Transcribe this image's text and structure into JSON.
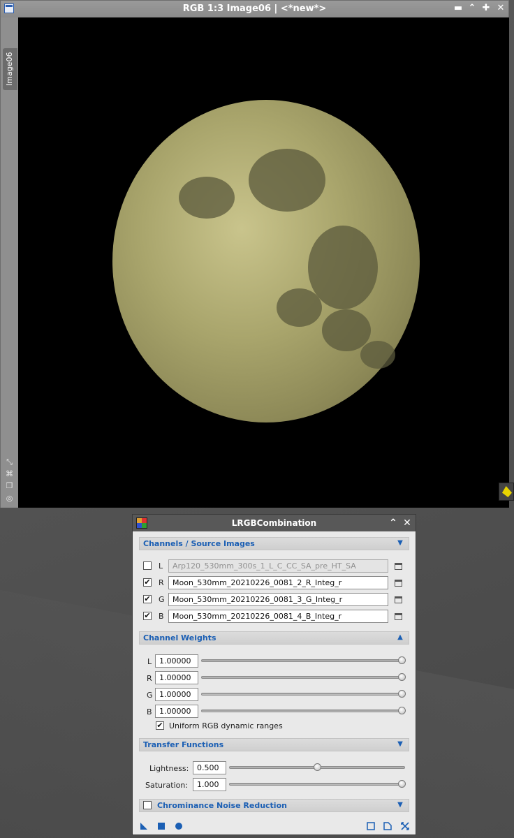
{
  "image_window": {
    "title": "RGB 1:3 Image06 | <*new*>",
    "side_tab_label": "Image06",
    "buttons": {
      "minimize": "▬",
      "shade": "⌃",
      "maximize": "✚",
      "close": "✕"
    }
  },
  "dialog": {
    "title": "LRGBCombination",
    "sections": {
      "channels": {
        "title": "Channels / Source Images",
        "expanded": true
      },
      "weights": {
        "title": "Channel Weights",
        "expanded": true
      },
      "transfer": {
        "title": "Transfer Functions",
        "expanded": true
      },
      "noise": {
        "title": "Chrominance Noise Reduction",
        "expanded": false,
        "enabled": false
      }
    },
    "channels": [
      {
        "label": "L",
        "checked": false,
        "image": "Arp120_530mm_300s_1_L_C_CC_SA_pre_HT_SA"
      },
      {
        "label": "R",
        "checked": true,
        "image": "Moon_530mm_20210226_0081_2_R_Integ_r"
      },
      {
        "label": "G",
        "checked": true,
        "image": "Moon_530mm_20210226_0081_3_G_Integ_r"
      },
      {
        "label": "B",
        "checked": true,
        "image": "Moon_530mm_20210226_0081_4_B_Integ_r"
      }
    ],
    "weights": [
      {
        "label": "L",
        "value": "1.00000",
        "level": 1.0
      },
      {
        "label": "R",
        "value": "1.00000",
        "level": 1.0
      },
      {
        "label": "G",
        "value": "1.00000",
        "level": 1.0
      },
      {
        "label": "B",
        "value": "1.00000",
        "level": 1.0
      }
    ],
    "uniform_rgb": {
      "label": "Uniform RGB dynamic ranges",
      "checked": true
    },
    "transfer": {
      "lightness": {
        "label": "Lightness:",
        "value": "0.500",
        "level": 0.5
      },
      "saturation": {
        "label": "Saturation:",
        "value": "1.000",
        "level": 1.0
      }
    },
    "check_mark": "✔",
    "colors": {
      "section_title": "#1b5fb4",
      "footer_icon": "#1b5fb4"
    }
  }
}
